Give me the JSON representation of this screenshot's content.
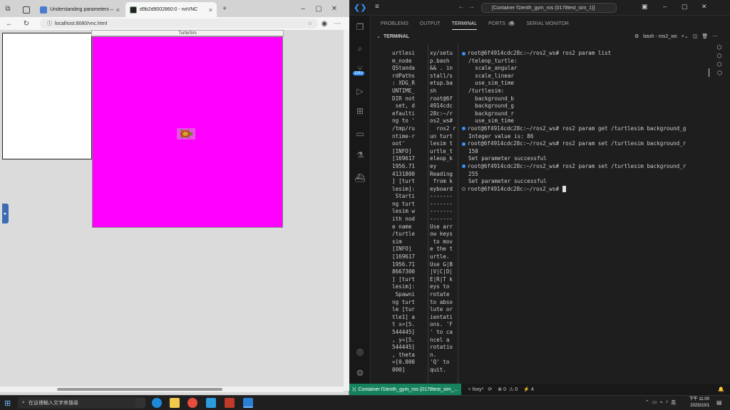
{
  "browser": {
    "tabs": [
      {
        "label": "",
        "active": false
      },
      {
        "label": "Understanding parameters — RO",
        "active": false
      },
      {
        "label": "d9b2d9002860:0 - noVNC",
        "active": true
      }
    ],
    "url": "localhost:8080/vnc.html",
    "vnc": {
      "turtlesim_title": "TurtleSim",
      "background_color": "#ff00ff"
    }
  },
  "vscode": {
    "title": "[Container f1tenth_gym_ros (0178test_sim_1)]",
    "panel_tabs": [
      "PROBLEMS",
      "OUTPUT",
      "TERMINAL",
      "PORTS",
      "SERIAL MONITOR"
    ],
    "ports_count": "4",
    "terminal_header": "TERMINAL",
    "shell_label": "bash - ros2_ws",
    "activity_badge": "12K+",
    "term_col1": [
      "urtlesi",
      "m_node",
      "QStanda",
      "rdPaths",
      ": XDG_R",
      "UNTIME_",
      "DIR not",
      " set, d",
      "efaulti",
      "ng to '",
      "/tmp/ru",
      "ntime-r",
      "oot'",
      "[INFO]",
      "[169617",
      "1956.71",
      "4131800",
      "] [turt",
      "lesim]:",
      " Starti",
      "ng turt",
      "lesim w",
      "ith nod",
      "e name",
      "/turtle",
      "sim",
      "[INFO]",
      "[169617",
      "1956.71",
      "8667300",
      "] [turt",
      "lesim]:",
      " Spawni",
      "ng turt",
      "le [tur",
      "tle1] a",
      "t x=[5.",
      "544445]",
      ", y=[5.",
      "544445]",
      ", theta",
      "=[0.000",
      "000]"
    ],
    "term_col2": [
      "xy/setu",
      "p.bash",
      "&& . in",
      "stall/s",
      "etup.ba",
      "sh",
      "root@6f",
      "4914cdc",
      "28c:~/r",
      "os2_ws#",
      "  ros2 r",
      "un turt",
      "lesim t",
      "urtle_t",
      "eleop_k",
      "ey",
      "Reading",
      " from k",
      "eyboard",
      "-------",
      "-------",
      "-------",
      "-------",
      "Use arr",
      "ow keys",
      " to mov",
      "e the t",
      "urtle.",
      "Use G|B",
      "|V|C|D|",
      "E|R|T k",
      "eys to",
      "rotate",
      "to abso",
      "lute or",
      "ientati",
      "ons. 'F",
      "' to ca",
      "ncel a",
      "rotatio",
      "n.",
      "'Q' to",
      "quit."
    ],
    "term_lines": [
      {
        "prompt": "root@6f4914cdc28c:~/ros2_ws#",
        "text": " ros2 param list",
        "dot": true
      },
      {
        "prompt": "",
        "text": "/teleop_turtle:",
        "dot": false
      },
      {
        "prompt": "",
        "text": "  scale_angular",
        "dot": false
      },
      {
        "prompt": "",
        "text": "  scale_linear",
        "dot": false
      },
      {
        "prompt": "",
        "text": "  use_sim_time",
        "dot": false
      },
      {
        "prompt": "",
        "text": "/turtlesim:",
        "dot": false
      },
      {
        "prompt": "",
        "text": "  background_b",
        "dot": false
      },
      {
        "prompt": "",
        "text": "  background_g",
        "dot": false
      },
      {
        "prompt": "",
        "text": "  background_r",
        "dot": false
      },
      {
        "prompt": "",
        "text": "  use_sim_time",
        "dot": false
      },
      {
        "prompt": "root@6f4914cdc28c:~/ros2_ws#",
        "text": " ros2 param get /turtlesim background_g",
        "dot": true
      },
      {
        "prompt": "",
        "text": "Integer value is: 86",
        "dot": false
      },
      {
        "prompt": "root@6f4914cdc28c:~/ros2_ws#",
        "text": " ros2 param set /turtlesim background_r",
        "dot": true
      },
      {
        "prompt": "",
        "text": "150",
        "dot": false
      },
      {
        "prompt": "",
        "text": "Set parameter successful",
        "dot": false
      },
      {
        "prompt": "root@6f4914cdc28c:~/ros2_ws#",
        "text": " ros2 param set /turtlesim background_r",
        "dot": true
      },
      {
        "prompt": "",
        "text": "255",
        "dot": false
      },
      {
        "prompt": "",
        "text": "Set parameter successful",
        "dot": false
      },
      {
        "prompt": "root@6f4914cdc28c:~/ros2_ws#",
        "text": " ",
        "dot": "grey"
      }
    ],
    "status": {
      "remote": "Container f1tenth_gym_ros (0178test_sim_...",
      "branch": "foxy*",
      "errors": "0",
      "warnings": "0",
      "ports": "4"
    }
  },
  "taskbar": {
    "search_placeholder": "在這裡輸入文字來搜尋",
    "time": "下午 11:00",
    "date": "2023/10/1",
    "lang": "英"
  }
}
